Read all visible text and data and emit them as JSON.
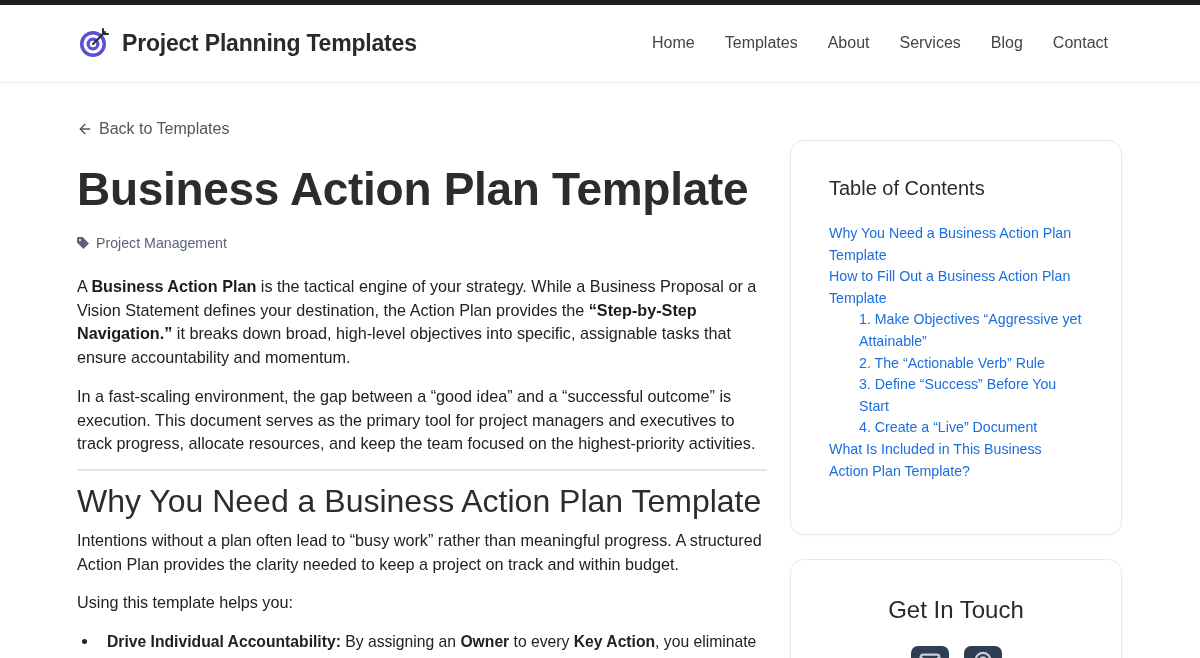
{
  "header": {
    "site_title": "Project Planning Templates",
    "nav": [
      {
        "label": "Home",
        "selected": false
      },
      {
        "label": "Templates",
        "selected": false
      },
      {
        "label": "About",
        "selected": false
      },
      {
        "label": "Services",
        "selected": false
      },
      {
        "label": "Blog",
        "selected": false
      },
      {
        "label": "Contact",
        "selected": false
      }
    ]
  },
  "article": {
    "back_link": "Back to Templates",
    "title": "Business Action Plan Template",
    "category": "Project Management",
    "blocks": [
      {
        "kind": "paragraph",
        "text": "A **Business Action Plan** is the tactical engine of your strategy. While a Business Proposal or a Vision Statement defines your destination, the Action Plan provides the **“Step-by-Step Navigation.”** it breaks down broad, high-level objectives into specific, assignable tasks that ensure accountability and momentum."
      },
      {
        "kind": "paragraph",
        "text": "In a fast-scaling environment, the gap between a “good idea” and a “successful outcome” is execution. This document serves as the primary tool for project managers and executives to track progress, allocate resources, and keep the team focused on the highest-priority activities."
      },
      {
        "kind": "rule"
      },
      {
        "kind": "heading",
        "text": "Why You Need a Business Action Plan Template"
      },
      {
        "kind": "paragraph",
        "text": "Intentions without a plan often lead to “busy work” rather than meaningful progress. A structured Action Plan provides the clarity needed to keep a project on track and within budget."
      },
      {
        "kind": "paragraph",
        "text": "Using this template helps you:"
      },
      {
        "kind": "bullet",
        "text": "**Drive Individual Accountability:** By assigning an **Owner** to every **Key Action**, you eliminate"
      }
    ]
  },
  "toc": {
    "title": "Table of Contents",
    "items": [
      {
        "label": "Why You Need a Business Action Plan Template"
      },
      {
        "label": "How to Fill Out a Business Action Plan Template",
        "children": [
          {
            "label": "1. Make Objectives “Aggressive yet Attainable”"
          },
          {
            "label": "2. The “Actionable Verb” Rule"
          },
          {
            "label": "3. Define “Success” Before You Start"
          },
          {
            "label": "4. Create a “Live” Document"
          }
        ]
      },
      {
        "label": "What Is Included in This Business Action Plan Template?"
      }
    ]
  },
  "contact": {
    "title": "Get In Touch",
    "links": [
      {
        "kind": "email"
      },
      {
        "kind": "location"
      }
    ]
  }
}
